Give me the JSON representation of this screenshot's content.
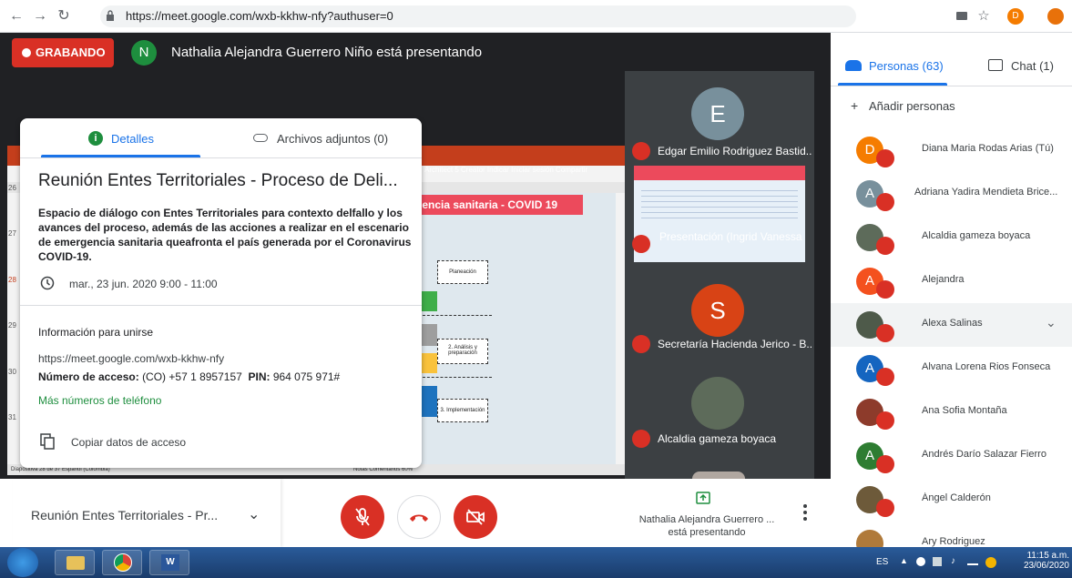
{
  "browser": {
    "url": "https://meet.google.com/wxb-kkhw-nfy?authuser=0",
    "profile_letter": "D"
  },
  "stage": {
    "recording_label": "GRABANDO",
    "presenter_initial": "N",
    "presenting_text": "Nathalia Alejandra Guerrero Niño está presentando"
  },
  "slide": {
    "title": "gencia sanitaria - COVID 19",
    "toolbar": "Architect 5 Creator   Indicar   Iniciar sesión   Compartir",
    "boxes": [
      "Planeación",
      "2. Análisis y preparación",
      "3. Implementación"
    ],
    "status_left": "Diapositiva 28 de 37    Español (Colombia)",
    "status_right": "Notas   Comentarios      60%",
    "line_numbers": [
      "26",
      "27",
      "28",
      "29",
      "30",
      "31"
    ]
  },
  "details": {
    "tab_details": "Detalles",
    "tab_attachments": "Archivos adjuntos (0)",
    "title": "Reunión Entes Territoriales - Proceso de Deli...",
    "description": "Espacio de diálogo con Entes Territoriales para contexto delfallo y los avances del proceso, además de las acciones a realizar en el escenario de emergencia sanitaria queafronta el país generada por el Coronavirus COVID-19.",
    "datetime": "mar., 23 jun. 2020 9:00 - 11:00",
    "join_title": "Información para unirse",
    "join_url": "https://meet.google.com/wxb-kkhw-nfy",
    "access_label": "Número de acceso:",
    "access_value": "(CO) +57 1 8957157",
    "pin_label": "PIN:",
    "pin_value": "964 075 971#",
    "more_phones": "Más números de teléfono",
    "copy_label": "Copiar datos de acceso"
  },
  "tiles": [
    {
      "initial": "E",
      "name": "Edgar Emilio Rodriguez Bastid...",
      "color": "#78909c"
    },
    {
      "initial": "",
      "name": "Presentación (Ingrid Vanessa Cortes Martin...",
      "color": ""
    },
    {
      "initial": "S",
      "name": "Secretaría Hacienda Jerico - B...",
      "color": "#d84315"
    },
    {
      "initial": "",
      "name": "Alcaldia gameza boyaca",
      "color": "#5d6b5a"
    }
  ],
  "people_panel": {
    "tab_people": "Personas (63)",
    "tab_chat": "Chat (1)",
    "add_people": "Añadir personas",
    "participants": [
      {
        "initial": "D",
        "name": "Diana Maria Rodas Arias (Tú)",
        "color": "#f57c00"
      },
      {
        "initial": "A",
        "name": "Adriana Yadira Mendieta Brice...",
        "color": "#78909c"
      },
      {
        "initial": "",
        "name": "Alcaldia gameza boyaca",
        "color": "#5d6b5a"
      },
      {
        "initial": "A",
        "name": "Alejandra",
        "color": "#f4511e"
      },
      {
        "initial": "",
        "name": "Alexa Salinas",
        "color": "#4e5a4a"
      },
      {
        "initial": "A",
        "name": "Alvana Lorena Rios Fonseca",
        "color": "#1565c0"
      },
      {
        "initial": "",
        "name": "Ana Sofia Montaña",
        "color": "#8d3b2b"
      },
      {
        "initial": "A",
        "name": "Andrés Darío Salazar Fierro",
        "color": "#2e7d32"
      },
      {
        "initial": "",
        "name": "Ángel Calderón",
        "color": "#6d5a3a"
      },
      {
        "initial": "",
        "name": "Ary Rodriguez",
        "color": "#b07a3a"
      }
    ]
  },
  "controlbar": {
    "meeting_name": "Reunión Entes Territoriales - Pr...",
    "presenting_line1": "Nathalia Alejandra Guerrero ...",
    "presenting_line2": "está presentando"
  },
  "taskbar": {
    "lang": "ES",
    "time": "11:15 a.m.",
    "date": "23/06/2020"
  },
  "colors": {
    "accent": "#1a73e8",
    "danger": "#d93025",
    "green": "#1e8e3e"
  }
}
